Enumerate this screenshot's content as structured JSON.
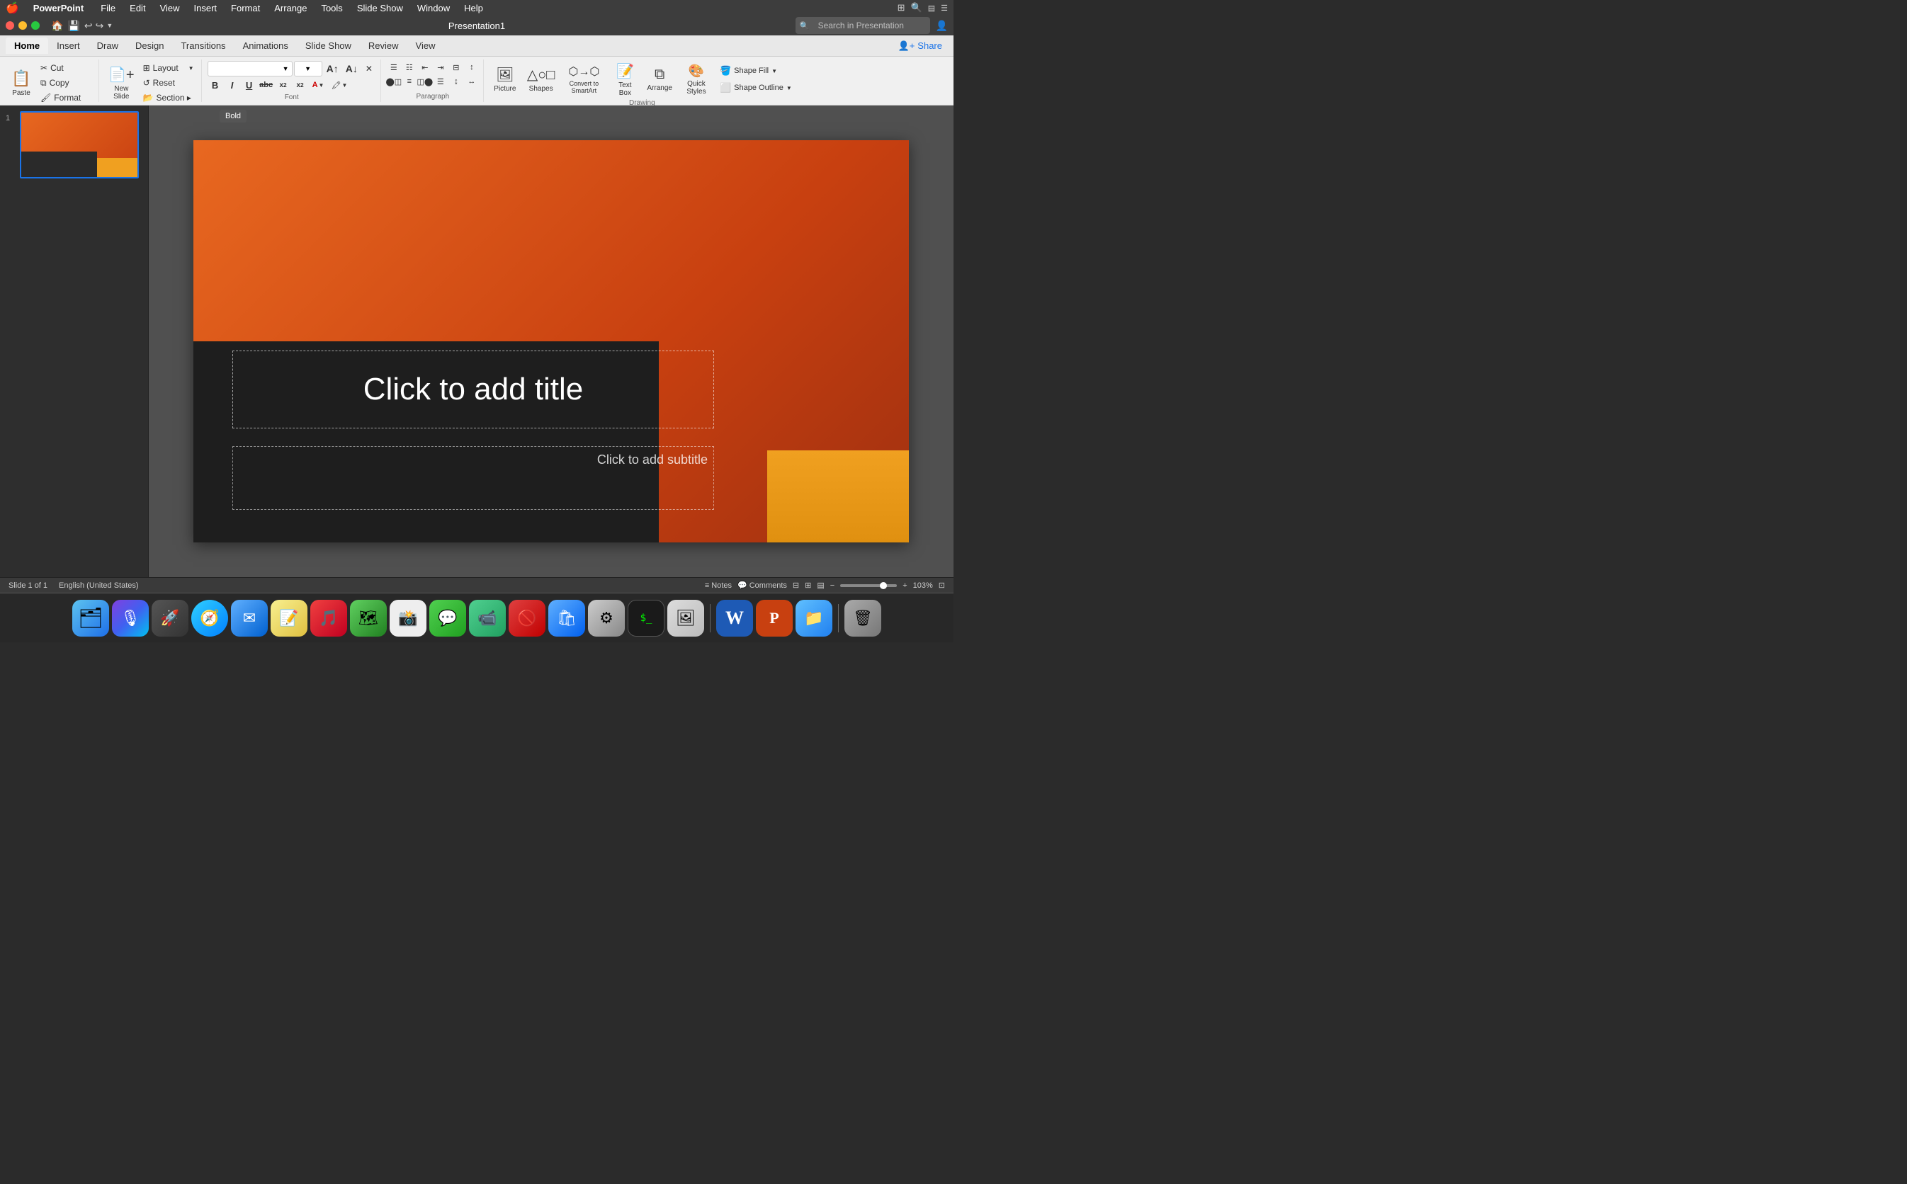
{
  "menubar": {
    "apple": "🍎",
    "appname": "PowerPoint",
    "items": [
      "File",
      "Edit",
      "View",
      "Insert",
      "Format",
      "Arrange",
      "Tools",
      "Slide Show",
      "Window",
      "Help"
    ]
  },
  "titlebar": {
    "title": "Presentation1",
    "search_placeholder": "Search in Presentation"
  },
  "ribbon": {
    "tabs": [
      "Home",
      "Insert",
      "Draw",
      "Design",
      "Transitions",
      "Animations",
      "Slide Show",
      "Review",
      "View"
    ],
    "active_tab": "Home",
    "share_label": "Share",
    "groups": {
      "clipboard": {
        "paste_label": "Paste",
        "cut_label": "Cut",
        "copy_label": "Copy",
        "format_label": "Format"
      },
      "slides": {
        "new_slide_label": "New\nSlide",
        "layout_label": "Layout",
        "reset_label": "Reset",
        "section_label": "Section ▸"
      },
      "font": {
        "font_name": "",
        "font_size": "",
        "bold_label": "B",
        "italic_label": "I",
        "underline_label": "U",
        "strikethrough_label": "abc",
        "superscript_label": "x²",
        "subscript_label": "x₂"
      },
      "paragraph": {
        "bullets_label": "☰",
        "numbered_label": "☷",
        "outdent_label": "⇤",
        "indent_label": "⇥"
      },
      "drawing": {
        "picture_label": "Picture",
        "shapes_label": "Shapes",
        "textbox_label": "Text\nBox",
        "arrange_label": "Arrange",
        "quick_styles_label": "Quick\nStyles",
        "shape_fill_label": "Shape Fill",
        "shape_outline_label": "Shape Outline"
      },
      "convert": {
        "label": "Convert to\nSmartArt"
      }
    }
  },
  "slide": {
    "title_placeholder": "Click to add title",
    "subtitle_placeholder": "Click to add subtitle"
  },
  "tooltip": {
    "bold": "Bold"
  },
  "statusbar": {
    "slide_info": "Slide 1 of 1",
    "language": "English (United States)",
    "notes_label": "Notes",
    "comments_label": "Comments",
    "zoom_level": "103%"
  },
  "dock": {
    "items": [
      {
        "name": "Finder",
        "icon": "🗂"
      },
      {
        "name": "Siri",
        "icon": "🎙"
      },
      {
        "name": "Launchpad",
        "icon": "🚀"
      },
      {
        "name": "Safari",
        "icon": "🧭"
      },
      {
        "name": "Mail",
        "icon": "✉"
      },
      {
        "name": "Notes",
        "icon": "📝"
      },
      {
        "name": "Music",
        "icon": "🎵"
      },
      {
        "name": "Maps",
        "icon": "🗺"
      },
      {
        "name": "Photos",
        "icon": "📷"
      },
      {
        "name": "Messages",
        "icon": "💬"
      },
      {
        "name": "FaceTime",
        "icon": "📹"
      },
      {
        "name": "Do Not Disturb",
        "icon": "🚫"
      },
      {
        "name": "App Store",
        "icon": "🛍"
      },
      {
        "name": "System Preferences",
        "icon": "⚙"
      },
      {
        "name": "Terminal",
        "icon": ">_"
      },
      {
        "name": "Preview",
        "icon": "🖼"
      },
      {
        "name": "Word",
        "icon": "W"
      },
      {
        "name": "PowerPoint",
        "icon": "P"
      },
      {
        "name": "Finder",
        "icon": "📁"
      },
      {
        "name": "Trash",
        "icon": "🗑"
      }
    ]
  },
  "colors": {
    "slide_bg_start": "#e86820",
    "slide_bg_end": "#a03010",
    "dark_band": "#1e1e1e",
    "orange_rect": "#f0a020",
    "accent_blue": "#1a73e8",
    "ribbon_bg": "#f0f0f0"
  }
}
